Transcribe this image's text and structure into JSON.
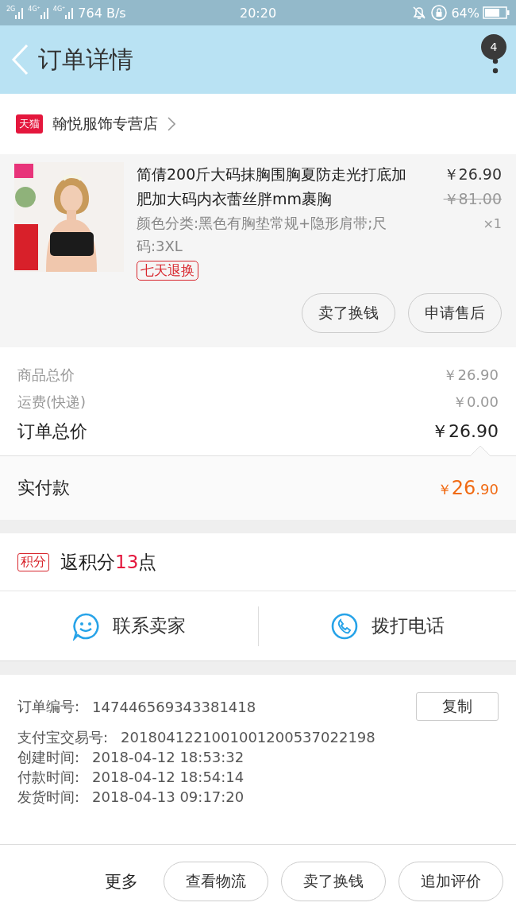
{
  "status_bar": {
    "signal_left": [
      "2G",
      "4G⁺",
      "4G⁺"
    ],
    "speed": "764 B/s",
    "time": "20:20",
    "battery": "64%"
  },
  "header": {
    "title": "订单详情",
    "badge": "4"
  },
  "shop": {
    "badge": "天猫",
    "name": "翰悦服饰专营店"
  },
  "product": {
    "kind": "picture",
    "title": "简倩200斤大码抹胸围胸夏防走光打底加肥加大码内衣蕾丝胖mm裹胸",
    "spec": "颜色分类:黑色有胸垫常规+隐形肩带;尺码:3XL",
    "tag": "七天退换",
    "price": "￥26.90",
    "original_price": "￥81.00",
    "quantity": "×1",
    "actions": [
      "卖了换钱",
      "申请售后"
    ]
  },
  "summary": [
    {
      "label": "商品总价",
      "value": "￥26.90",
      "kind": "minor"
    },
    {
      "label": "运费(快递)",
      "value": "￥0.00",
      "kind": "minor"
    },
    {
      "label": "订单总价",
      "value": "￥26.90",
      "kind": "major"
    }
  ],
  "paid": {
    "label": "实付款",
    "currency": "￥",
    "integer": "26",
    "decimal": ".90"
  },
  "points": {
    "badge": "积分",
    "prefix": "返积分",
    "amount": "13",
    "suffix": "点"
  },
  "contact": [
    {
      "label": "联系卖家",
      "kind": "chat"
    },
    {
      "label": "拨打电话",
      "kind": "phone"
    }
  ],
  "order_info": {
    "copy_button": "复制",
    "rows": [
      {
        "label": "订单编号:",
        "value": "147446569343381418"
      },
      {
        "label": "支付宝交易号:",
        "value": "2018041221001001200537022198"
      },
      {
        "label": "创建时间:",
        "value": "2018-04-12 18:53:32"
      },
      {
        "label": "付款时间:",
        "value": "2018-04-12 18:54:14"
      },
      {
        "label": "发货时间:",
        "value": "2018-04-13 09:17:20"
      }
    ]
  },
  "bottom_bar": {
    "more": "更多",
    "buttons": [
      "查看物流",
      "卖了换钱",
      "追加评价"
    ]
  }
}
